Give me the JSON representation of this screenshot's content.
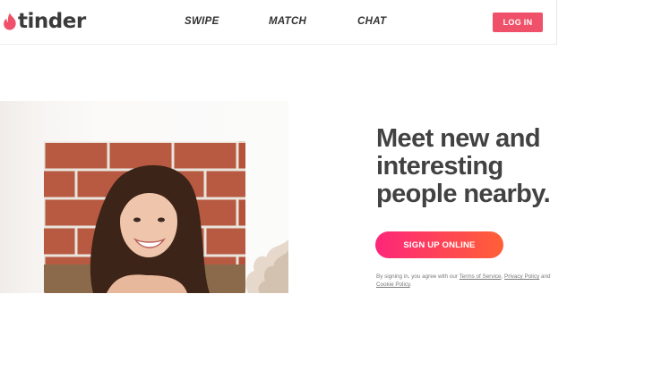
{
  "header": {
    "logo_text": "tinder",
    "nav": [
      "SWIPE",
      "MATCH",
      "CHAT"
    ],
    "login_label": "LOG IN"
  },
  "hero": {
    "headline_lines": [
      "Meet new and",
      "interesting",
      "people nearby."
    ],
    "signup_label": "SIGN UP ONLINE",
    "legal": {
      "prefix": "By signing in, you agree with our ",
      "terms": "Terms of Service",
      "sep": ", ",
      "privacy": "Privacy Policy",
      "and": " and ",
      "cookie": "Cookie Policy",
      "suffix": "."
    }
  },
  "colors": {
    "brand": "#f0516a",
    "gradient_start": "#fd267a",
    "gradient_end": "#ff6036",
    "text_dark": "#424242"
  },
  "icons": {
    "logo": "flame-icon"
  }
}
